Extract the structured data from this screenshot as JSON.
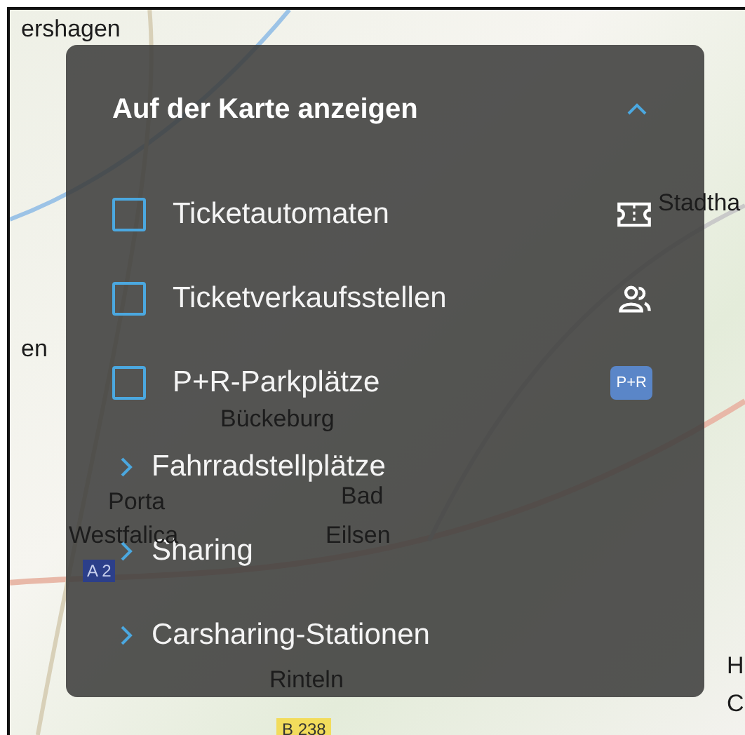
{
  "map": {
    "labels": [
      {
        "text": "ershagen",
        "kind": "place"
      },
      {
        "text": "Stadtha",
        "kind": "place"
      },
      {
        "text": "en",
        "kind": "place"
      },
      {
        "text": "Bückeburg",
        "kind": "place"
      },
      {
        "text": "Porta",
        "kind": "place"
      },
      {
        "text": "Bad",
        "kind": "place"
      },
      {
        "text": "Westfalica",
        "kind": "place"
      },
      {
        "text": "Eilsen",
        "kind": "place"
      },
      {
        "text": "A 2",
        "kind": "motorway"
      },
      {
        "text": "Rinteln",
        "kind": "place"
      },
      {
        "text": "H",
        "kind": "place"
      },
      {
        "text": "C",
        "kind": "place"
      },
      {
        "text": "B 238",
        "kind": "road"
      }
    ]
  },
  "panel": {
    "title": "Auf der Karte anzeigen",
    "expanded": true,
    "items": [
      {
        "kind": "checkbox",
        "label": "Ticketautomaten",
        "checked": false
      },
      {
        "kind": "checkbox",
        "label": "Ticketverkaufsstellen",
        "checked": false
      },
      {
        "kind": "checkbox",
        "label": "P+R-Parkplätze",
        "checked": false,
        "badge": "P+R"
      },
      {
        "kind": "group",
        "label": "Fahrradstellplätze",
        "expanded": false
      },
      {
        "kind": "group",
        "label": "Sharing",
        "expanded": false
      },
      {
        "kind": "group",
        "label": "Carsharing-Stationen",
        "expanded": false
      }
    ]
  }
}
